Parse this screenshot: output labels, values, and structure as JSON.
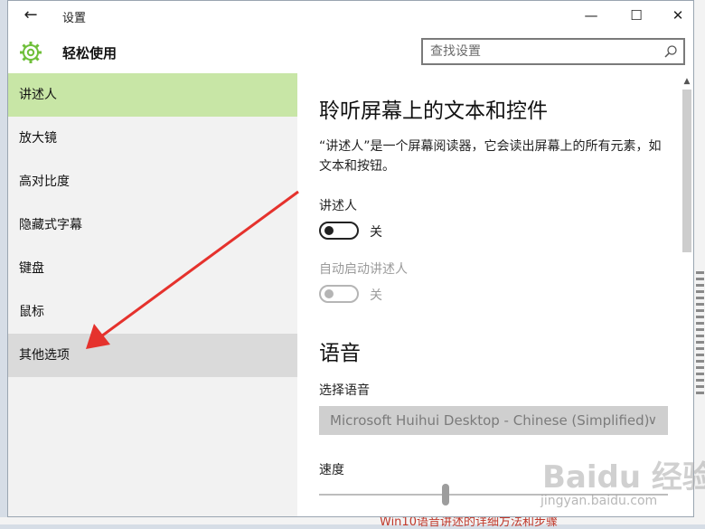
{
  "window": {
    "title": "设置",
    "header_title": "轻松使用",
    "search_placeholder": "查找设置"
  },
  "sidebar": {
    "items": [
      {
        "label": "讲述人"
      },
      {
        "label": "放大镜"
      },
      {
        "label": "高对比度"
      },
      {
        "label": "隐藏式字幕"
      },
      {
        "label": "键盘"
      },
      {
        "label": "鼠标"
      },
      {
        "label": "其他选项"
      }
    ]
  },
  "content": {
    "heading": "聆听屏幕上的文本和控件",
    "description": "“讲述人”是一个屏幕阅读器，它会读出屏幕上的所有元素，如文本和按钮。",
    "narrator_label": "讲述人",
    "narrator_state": "关",
    "autostart_label": "自动启动讲述人",
    "autostart_state": "关",
    "voice_heading": "语音",
    "choose_voice_label": "选择语音",
    "voice_value": "Microsoft Huihui Desktop - Chinese (Simplified)",
    "speed_label": "速度"
  },
  "background": {
    "link_text": "Win10语音讲述的详细方法和步骤"
  },
  "watermark": {
    "text": "Baidu 经验",
    "sub": "jingyan.baidu.com"
  },
  "colors": {
    "selected_nav": "#c8e6a6",
    "hover_nav": "#dadada",
    "gear_green": "#6fbf3a",
    "annotation_arrow": "#e5322d"
  }
}
